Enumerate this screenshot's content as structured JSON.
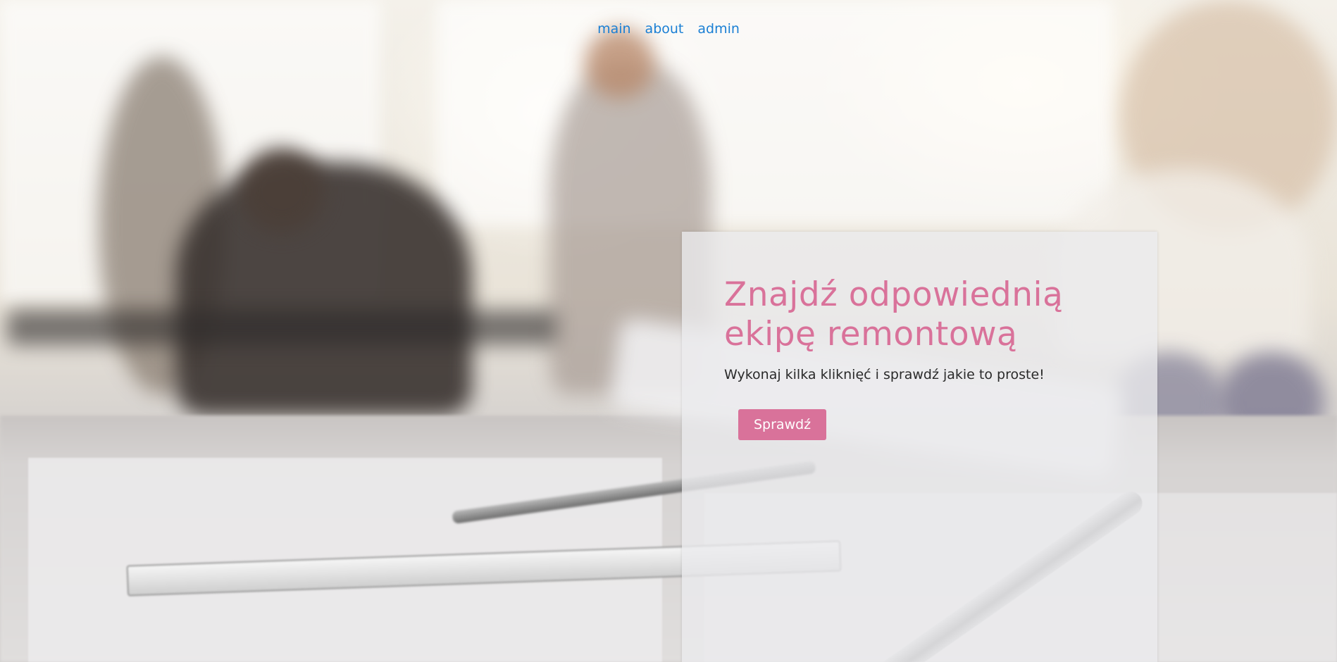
{
  "nav": {
    "items": [
      {
        "label": "main"
      },
      {
        "label": "about"
      },
      {
        "label": "admin"
      }
    ]
  },
  "hero": {
    "title": "Znajdź odpowiednią ekipę remontową",
    "subtitle": "Wykonaj kilka kliknięć i sprawdź jakie to proste!",
    "cta_label": "Sprawdź"
  },
  "colors": {
    "accent": "#d9729a",
    "link": "#1a7fd4",
    "text": "#2a2a2a"
  }
}
